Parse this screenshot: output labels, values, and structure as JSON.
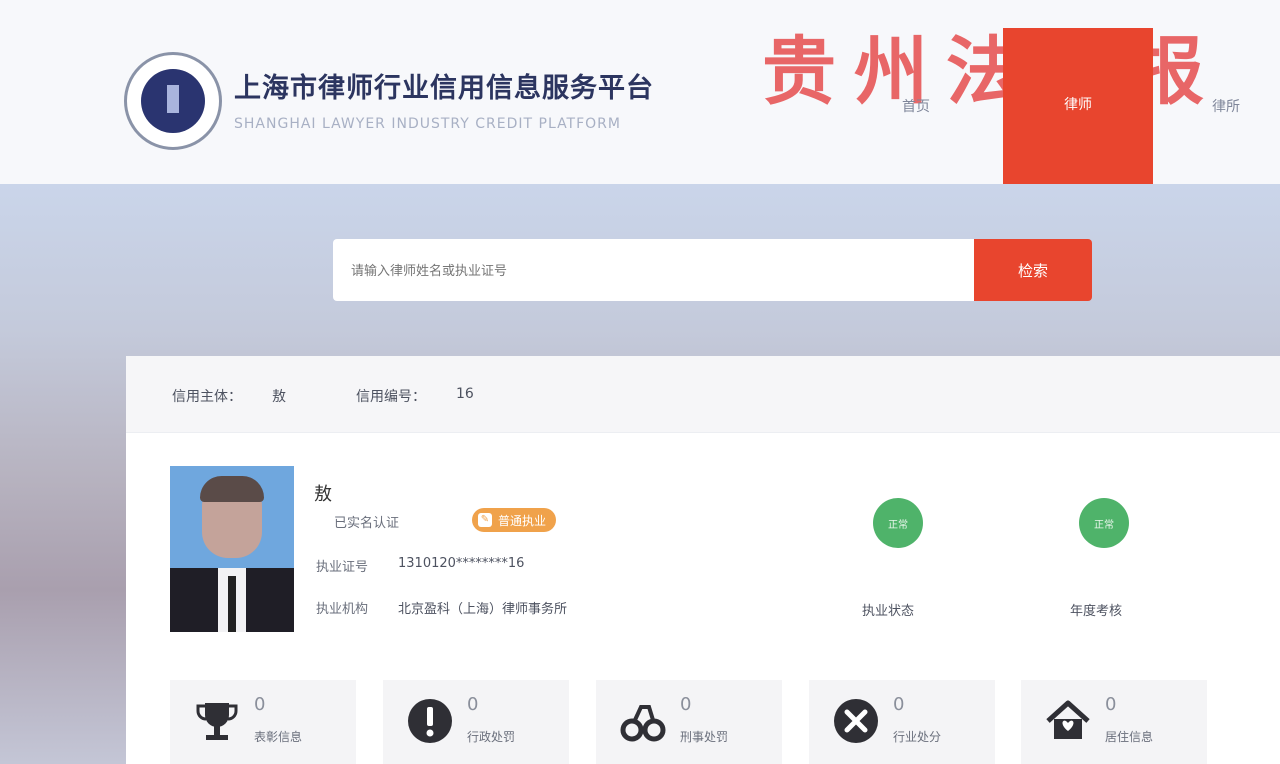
{
  "header": {
    "title_cn": "上海市律师行业信用信息服务平台",
    "title_en": "SHANGHAI LAWYER INDUSTRY CREDIT PLATFORM",
    "watermark": "贵州法治报",
    "nav": [
      {
        "label": "首页"
      },
      {
        "label": "律师"
      },
      {
        "label": "律所"
      }
    ]
  },
  "search": {
    "placeholder": "请输入律师姓名或执业证号",
    "button_label": "检索"
  },
  "credit_info": {
    "subject_label": "信用主体：",
    "subject_value": "敖",
    "code_label": "信用编号：",
    "code_value": "16"
  },
  "profile": {
    "name": "敖",
    "verify_text": "已实名认证",
    "badge": "普通执业",
    "license_label": "执业证号",
    "license_value": "1310120********16",
    "firm_label": "执业机构",
    "firm_value": "北京盈科（上海）律师事务所"
  },
  "status": [
    {
      "circle": "正常",
      "label": "执业状态"
    },
    {
      "circle": "正常",
      "label": "年度考核"
    }
  ],
  "stats": [
    {
      "icon": "trophy-icon",
      "count": "0",
      "label": "表彰信息"
    },
    {
      "icon": "exclamation-icon",
      "count": "0",
      "label": "行政处罚"
    },
    {
      "icon": "handcuffs-icon",
      "count": "0",
      "label": "刑事处罚"
    },
    {
      "icon": "close-circle-icon",
      "count": "0",
      "label": "行业处分"
    },
    {
      "icon": "house-icon",
      "count": "0",
      "label": "居住信息"
    }
  ],
  "colors": {
    "accent": "#e8452e",
    "navy": "#2c3560",
    "status_green": "#4fb36a",
    "badge_orange": "#f0a24b"
  }
}
